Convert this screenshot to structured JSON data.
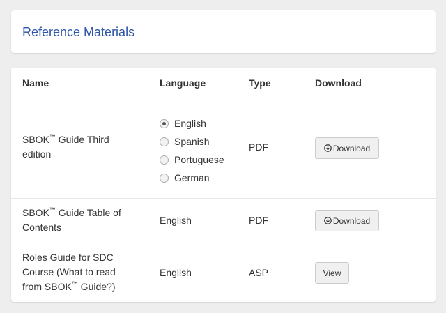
{
  "header": {
    "title": "Reference Materials"
  },
  "table": {
    "columns": [
      "Name",
      "Language",
      "Type",
      "Download"
    ],
    "rows": [
      {
        "name_lines": [
          "SBOK",
          "™",
          " Guide Third",
          "edition"
        ],
        "languages": [
          {
            "label": "English",
            "checked": true
          },
          {
            "label": "Spanish",
            "checked": false
          },
          {
            "label": "Portuguese",
            "checked": false
          },
          {
            "label": "German",
            "checked": false
          }
        ],
        "type": "PDF",
        "action": "Download"
      },
      {
        "name_lines": [
          "SBOK",
          "™",
          " Guide Table of",
          "Contents"
        ],
        "language": "English",
        "type": "PDF",
        "action": "Download"
      },
      {
        "name_lines": [
          "Roles Guide for SDC",
          "Course (What to read",
          "from SBOK",
          "™",
          " Guide?)"
        ],
        "language": "English",
        "type": "ASP",
        "action": "View"
      }
    ]
  },
  "icons": {
    "download": "download-circle-icon"
  }
}
